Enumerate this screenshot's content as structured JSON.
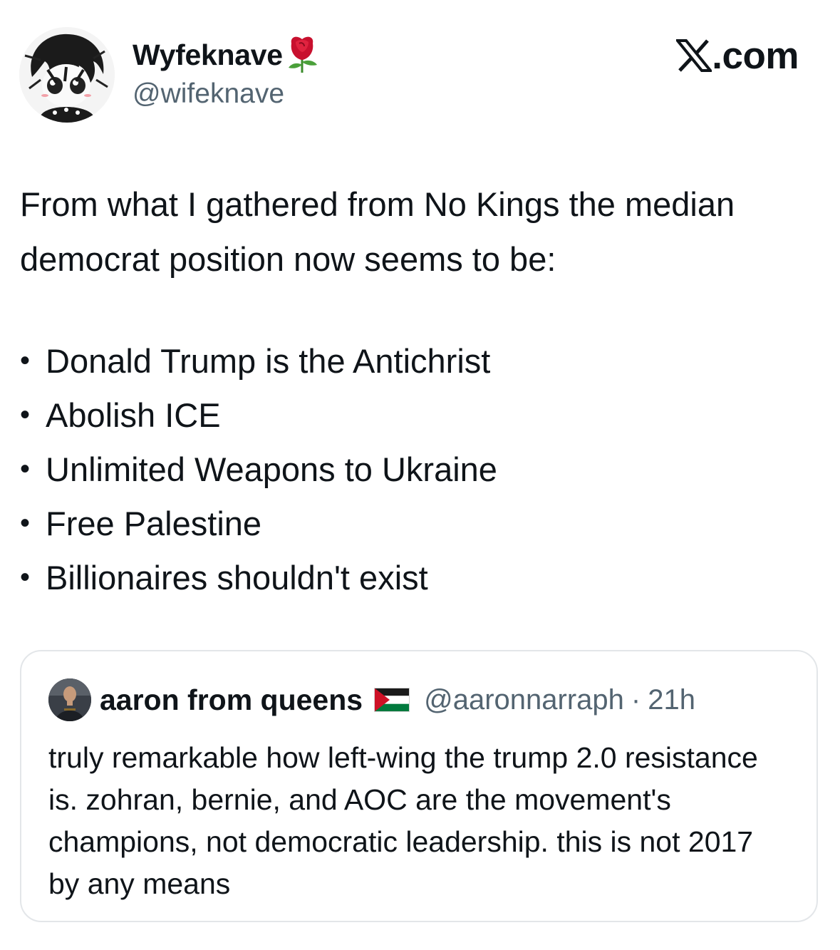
{
  "author": {
    "display_name": "Wyfeknave",
    "handle": "@wifeknave",
    "badge_icon": "rose-icon",
    "avatar_icon": "anime-avatar-icon"
  },
  "source": {
    "logo_icon": "x-logo-icon",
    "label": ".com"
  },
  "tweet": {
    "intro": "From what I gathered from No Kings the median democrat position now seems to be:",
    "bullets": [
      "Donald Trump is the Antichrist",
      "Abolish ICE",
      "Unlimited Weapons to Ukraine",
      "Free Palestine",
      "Billionaires shouldn't exist"
    ],
    "bullet_marker": "•"
  },
  "quoted_tweet": {
    "display_name": "aaron from queens",
    "flag_icon": "palestine-flag-icon",
    "handle": "@aaronnarraph",
    "separator": "·",
    "time": "21h",
    "text": "truly remarkable how left-wing the trump 2.0 resistance is. zohran, bernie, and AOC are the movement's champions, not democratic leadership. this is not 2017 by any means"
  },
  "colors": {
    "text_primary": "#0f1419",
    "text_secondary": "#536471",
    "card_border": "#e3e6e9",
    "background": "#ffffff",
    "rose_red": "#c8102e",
    "flag_red": "#ce1126",
    "flag_green": "#007a3d"
  }
}
